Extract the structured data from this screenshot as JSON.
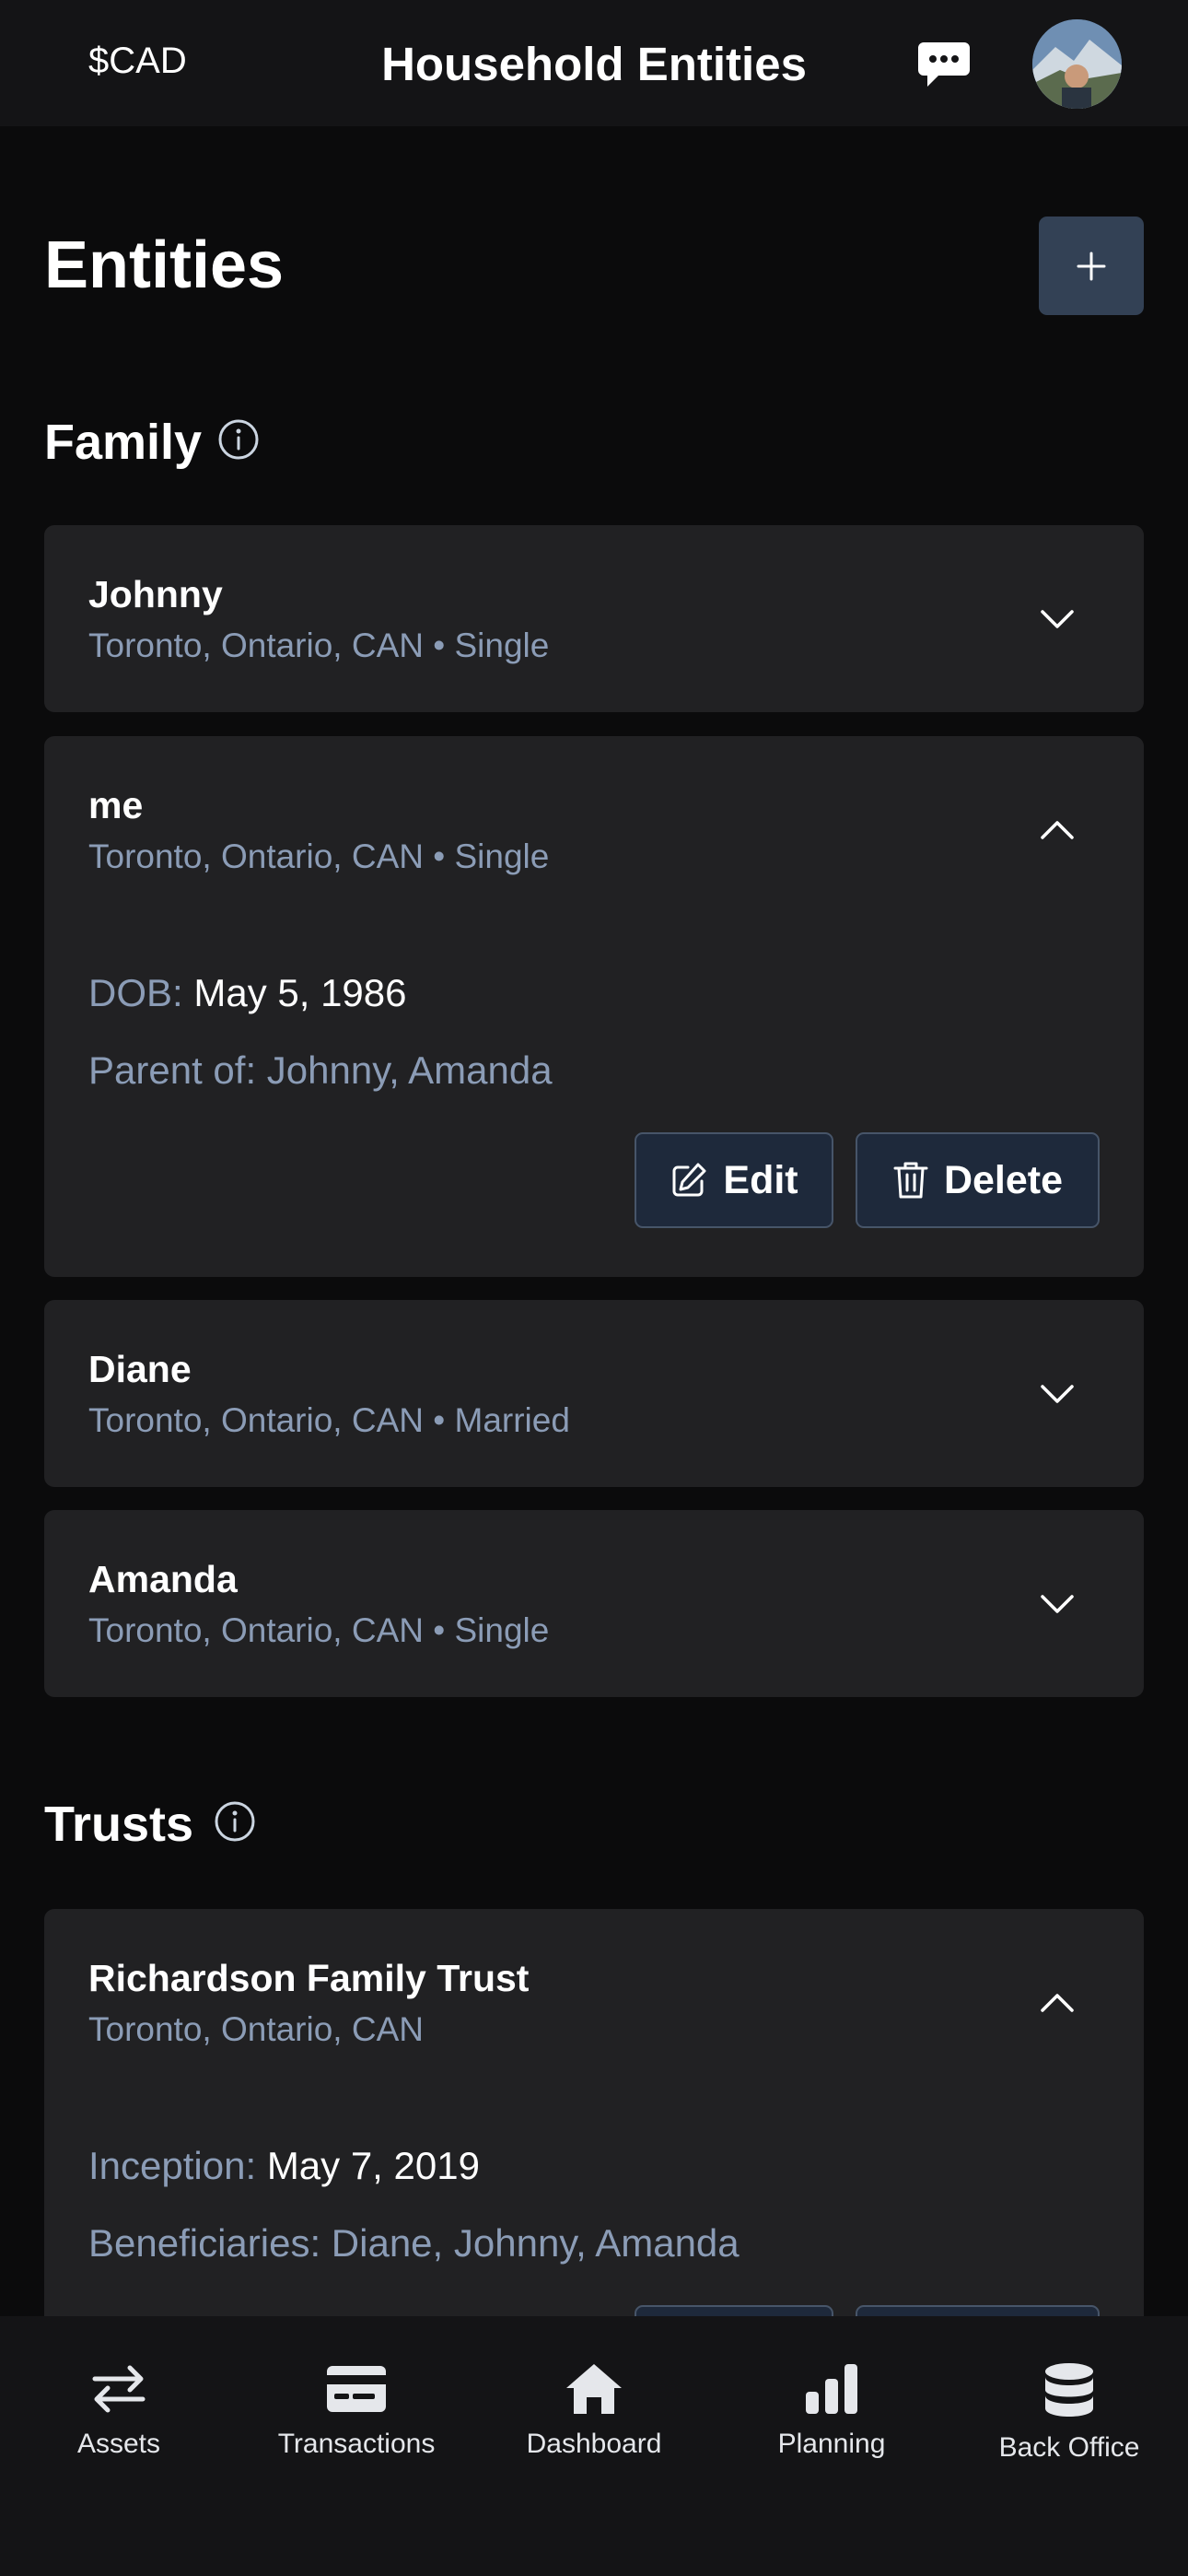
{
  "header": {
    "currency": "$CAD",
    "title": "Household Entities"
  },
  "page": {
    "title": "Entities"
  },
  "family": {
    "title": "Family",
    "items": [
      {
        "name": "Johnny",
        "subtitle": "Toronto, Ontario, CAN • Single",
        "expanded": false
      },
      {
        "name": "me",
        "subtitle": "Toronto, Ontario, CAN • Single",
        "expanded": true,
        "dob_label": "DOB:",
        "dob_value": "May 5, 1986",
        "parent_of": "Parent of: Johnny, Amanda",
        "edit_label": "Edit",
        "delete_label": "Delete"
      },
      {
        "name": "Diane",
        "subtitle": "Toronto, Ontario, CAN • Married",
        "expanded": false
      },
      {
        "name": "Amanda",
        "subtitle": "Toronto, Ontario, CAN • Single",
        "expanded": false
      }
    ]
  },
  "trusts": {
    "title": "Trusts",
    "items": [
      {
        "name": "Richardson Family Trust",
        "subtitle": "Toronto, Ontario, CAN",
        "expanded": true,
        "inception_label": "Inception:",
        "inception_value": "May 7, 2019",
        "beneficiaries": "Beneficiaries: Diane, Johnny, Amanda"
      }
    ]
  },
  "tabbar": {
    "items": [
      {
        "label": "Assets",
        "icon": "arrows-exchange-icon"
      },
      {
        "label": "Transactions",
        "icon": "credit-card-icon"
      },
      {
        "label": "Dashboard",
        "icon": "home-icon"
      },
      {
        "label": "Planning",
        "icon": "bar-chart-icon"
      },
      {
        "label": "Back Office",
        "icon": "database-icon"
      }
    ]
  },
  "colors": {
    "background": "#0b0b0c",
    "card": "#212123",
    "muted_text": "#8b9cb6",
    "button_bg": "#1e293b",
    "add_button": "#334155"
  }
}
